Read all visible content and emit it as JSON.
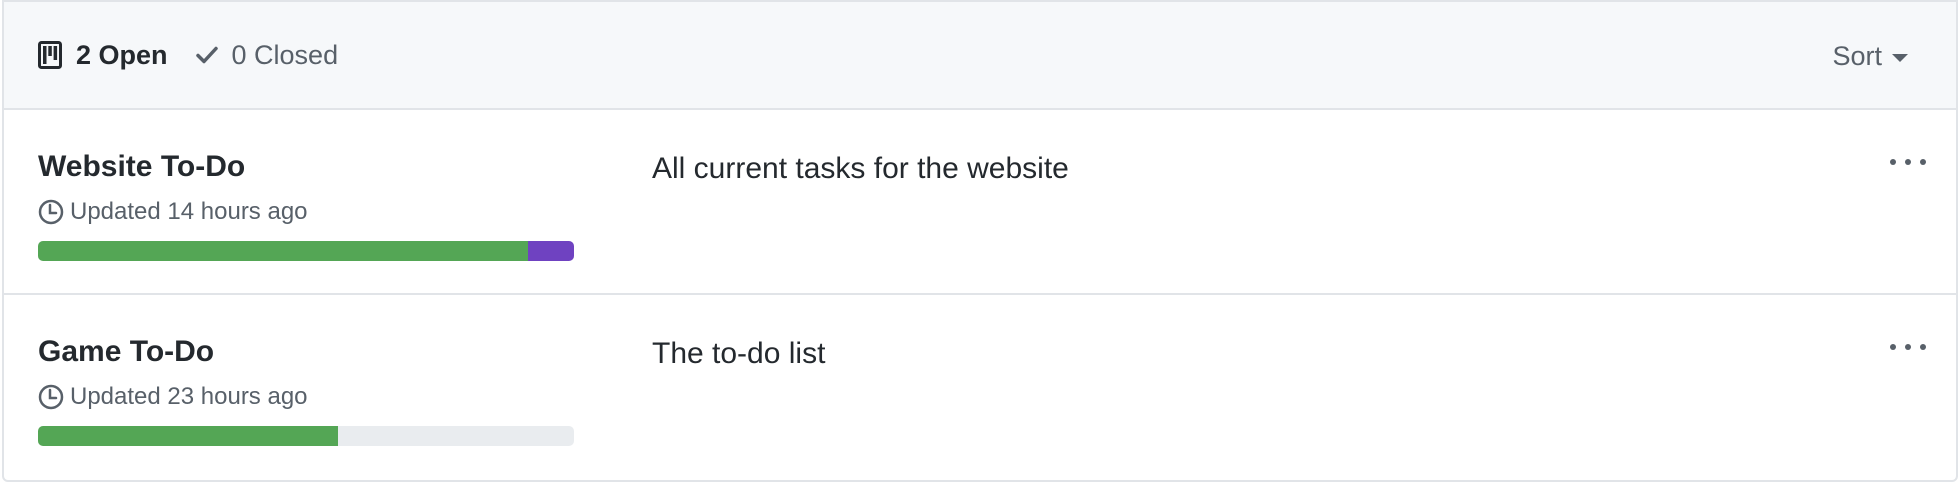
{
  "header": {
    "open_label": "2 Open",
    "closed_label": "0 Closed",
    "sort_label": "Sort"
  },
  "projects": [
    {
      "title": "Website To-Do",
      "updated": "Updated 14 hours ago",
      "description": "All current tasks for the website",
      "progress": {
        "done_fraction": 0.915,
        "in_progress_fraction": 0.085
      }
    },
    {
      "title": "Game To-Do",
      "updated": "Updated 23 hours ago",
      "description": "The to-do list",
      "progress": {
        "done_fraction": 0.56,
        "in_progress_fraction": 0.0
      }
    }
  ],
  "colors": {
    "done": "#54a655",
    "in_progress": "#6f42c1",
    "track": "#e9ecef"
  },
  "icons": {
    "open": "project-board-icon",
    "closed": "check-icon",
    "updated": "clock-icon",
    "more": "kebab-horizontal-icon"
  }
}
